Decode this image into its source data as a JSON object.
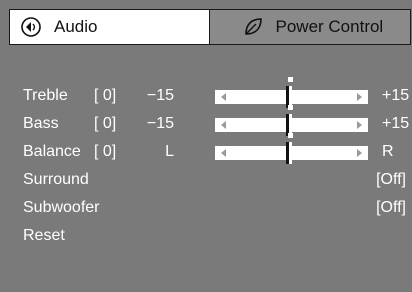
{
  "tabs": {
    "audio": {
      "label": "Audio",
      "icon": "audio-speaker-icon"
    },
    "power": {
      "label": "Power Control",
      "icon": "leaf-icon"
    }
  },
  "menu": {
    "items": [
      {
        "name": "Treble",
        "value": "[ 0]",
        "min": "−15",
        "max": "+15",
        "slider_level": 0.5
      },
      {
        "name": "Bass",
        "value": "[ 0]",
        "min": "−15",
        "max": "+15",
        "slider_level": 0.5
      },
      {
        "name": "Balance",
        "value": "[ 0]",
        "min": "L",
        "max": "R",
        "slider_level": 0.5
      },
      {
        "name": "Surround",
        "option": "[Off]"
      },
      {
        "name": "Subwoofer",
        "option": "[Off]"
      },
      {
        "name": "Reset"
      }
    ]
  },
  "colors": {
    "background": "#7a7a7a",
    "active_tab": "#ffffff",
    "inactive_tab": "#8a8a8a",
    "text": "#ffffff"
  }
}
